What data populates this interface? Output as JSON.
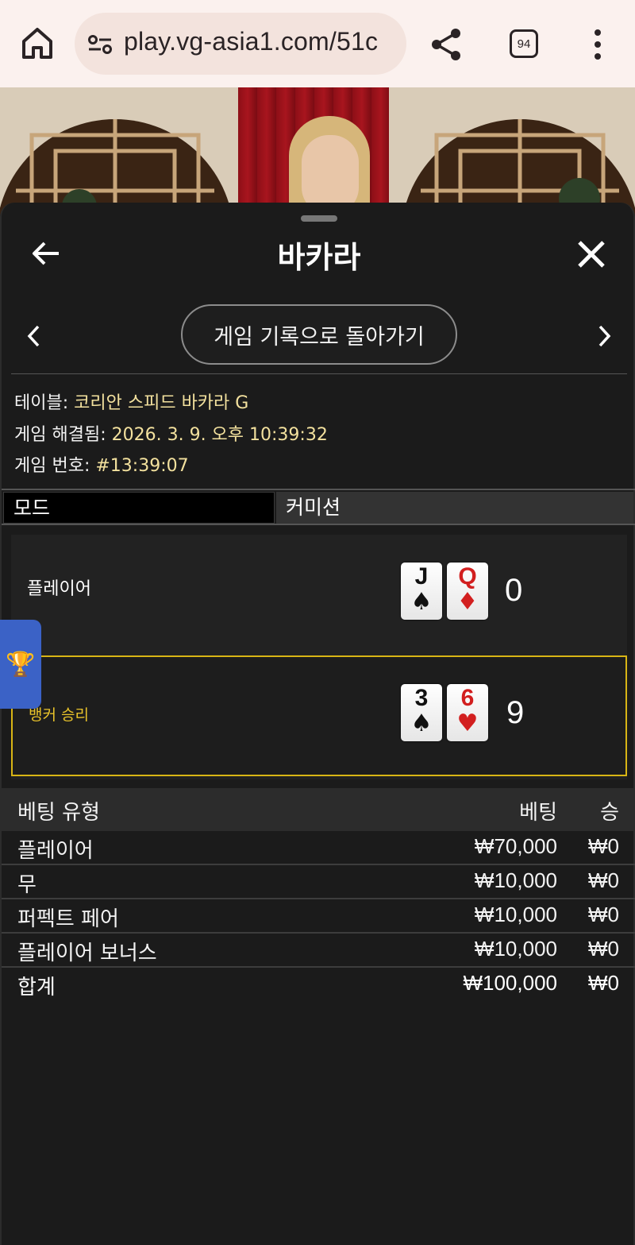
{
  "browser": {
    "url": "play.vg-asia1.com/51c",
    "tab_count": "94"
  },
  "panel": {
    "title": "바카라",
    "history_button": "게임 기록으로 돌아가기"
  },
  "info": {
    "table_label": "테이블: ",
    "table_value": "코리안 스피드 바카라 G",
    "resolved_label": "게임 해결됨: ",
    "resolved_value": "2026. 3. 9. 오후 10:39:32",
    "game_no_label": "게임 번호: ",
    "game_no_value": "#13:39:07"
  },
  "mode": {
    "label": "모드",
    "value": "커미션"
  },
  "hands": {
    "player": {
      "label": "플레이어",
      "cards": [
        {
          "rank": "J",
          "suit": "♠",
          "color": "#111111"
        },
        {
          "rank": "Q",
          "suit": "♦",
          "color": "#d21f1f"
        }
      ],
      "score": "0"
    },
    "banker": {
      "label": "뱅커 승리",
      "cards": [
        {
          "rank": "3",
          "suit": "♠",
          "color": "#111111"
        },
        {
          "rank": "6",
          "suit": "♥",
          "color": "#d21f1f"
        }
      ],
      "score": "9"
    }
  },
  "bets": {
    "headers": {
      "type": "베팅 유형",
      "bet": "베팅",
      "win": "승"
    },
    "rows": [
      {
        "type": "플레이어",
        "bet": "₩70,000",
        "win": "₩0"
      },
      {
        "type": "무",
        "bet": "₩10,000",
        "win": "₩0"
      },
      {
        "type": "퍼펙트 페어",
        "bet": "₩10,000",
        "win": "₩0"
      },
      {
        "type": "플레이어 보너스",
        "bet": "₩10,000",
        "win": "₩0"
      }
    ],
    "total": {
      "type": "합계",
      "bet": "₩100,000",
      "win": "₩0"
    }
  },
  "colors": {
    "winner_highlight": "#d8b515",
    "info_value": "#f3e19e",
    "trophy_tab": "#3b62c6"
  },
  "icons": [
    "home-icon",
    "site-settings-icon",
    "share-icon",
    "tabs-icon",
    "more-vert-icon",
    "back-arrow-icon",
    "close-icon",
    "chevron-left-icon",
    "chevron-right-icon",
    "trophy-icon"
  ]
}
